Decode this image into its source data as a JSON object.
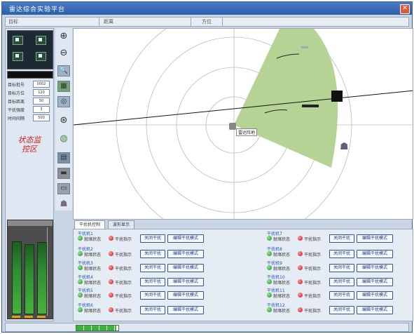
{
  "window": {
    "title": "雷达综合实验平台",
    "close_icon": "close-icon"
  },
  "colbar": {
    "col1": "目标",
    "col2": "距离",
    "col3": "方位"
  },
  "left": {
    "stats": [
      {
        "label": "目标批号",
        "value": "0002"
      },
      {
        "label": "目标方位",
        "value": "120"
      },
      {
        "label": "目标距离",
        "value": "50"
      },
      {
        "label": "干扰强度",
        "value": "3"
      },
      {
        "label": "时间间隔",
        "value": "500"
      }
    ],
    "status_word": "状态监控区",
    "meter": {
      "levels": [
        0.85,
        0.82,
        0.84
      ]
    }
  },
  "toolbar": {
    "icons": [
      "zoom-in-icon",
      "zoom-out-icon",
      "magnify-icon",
      "map-icon",
      "display-icon",
      "target-icon",
      "globe-icon",
      "radar-station-icon",
      "ship-icon",
      "aircraft-icon",
      "antenna-icon"
    ]
  },
  "radar": {
    "station_label": "雷达阵地"
  },
  "tabs": [
    "干扰机控制",
    "波形显示"
  ],
  "devices": [
    {
      "name": "干扰机1",
      "ready": "就绪状态",
      "indicator": "干扰指示",
      "btn1": "关闭干扰",
      "btn2": "编辑干扰模式"
    },
    {
      "name": "干扰机2",
      "ready": "就绪状态",
      "indicator": "干扰指示",
      "btn1": "关闭干扰",
      "btn2": "编辑干扰模式"
    },
    {
      "name": "干扰机3",
      "ready": "就绪状态",
      "indicator": "干扰指示",
      "btn1": "关闭干扰",
      "btn2": "编辑干扰模式"
    },
    {
      "name": "干扰机4",
      "ready": "就绪状态",
      "indicator": "干扰指示",
      "btn1": "关闭干扰",
      "btn2": "编辑干扰模式"
    },
    {
      "name": "干扰机5",
      "ready": "就绪状态",
      "indicator": "干扰指示",
      "btn1": "关闭干扰",
      "btn2": "编辑干扰模式"
    },
    {
      "name": "干扰机6",
      "ready": "就绪状态",
      "indicator": "干扰指示",
      "btn1": "关闭干扰",
      "btn2": "编辑干扰模式"
    },
    {
      "name": "干扰机7",
      "ready": "就绪状态",
      "indicator": "干扰指示",
      "btn1": "关闭干扰",
      "btn2": "编辑干扰模式"
    },
    {
      "name": "干扰机8",
      "ready": "就绪状态",
      "indicator": "干扰指示",
      "btn1": "关闭干扰",
      "btn2": "编辑干扰模式"
    },
    {
      "name": "干扰机9",
      "ready": "就绪状态",
      "indicator": "干扰指示",
      "btn1": "关闭干扰",
      "btn2": "编辑干扰模式"
    },
    {
      "name": "干扰机10",
      "ready": "就绪状态",
      "indicator": "干扰指示",
      "btn1": "关闭干扰",
      "btn2": "编辑干扰模式"
    },
    {
      "name": "干扰机11",
      "ready": "就绪状态",
      "indicator": "干扰指示",
      "btn1": "关闭干扰",
      "btn2": "编辑干扰模式"
    },
    {
      "name": "干扰机12",
      "ready": "就绪状态",
      "indicator": "干扰指示",
      "btn1": "关闭干扰",
      "btn2": "编辑干扰模式"
    }
  ],
  "status": {
    "progress": 0.95
  },
  "colors": {
    "sector": "#b5d394",
    "title_bar": "#2d5ea8",
    "alert": "#d21c1c"
  }
}
